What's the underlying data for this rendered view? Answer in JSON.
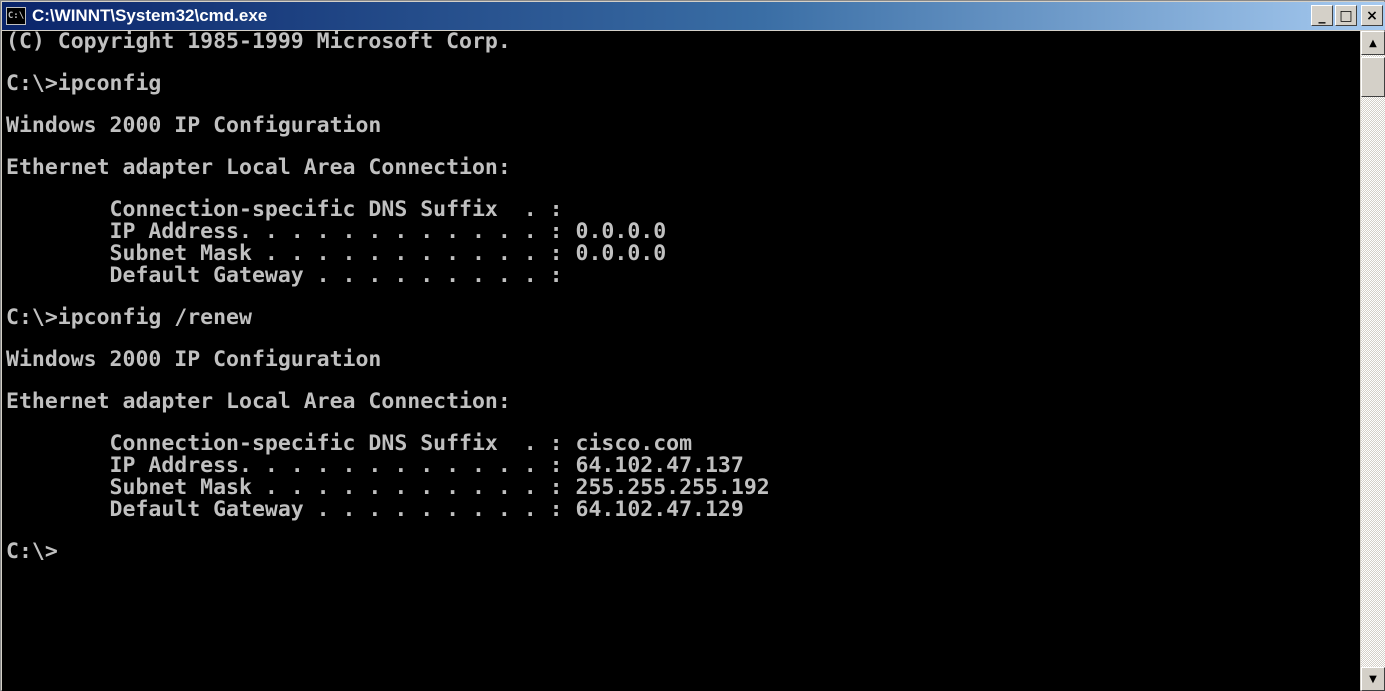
{
  "window": {
    "title": "C:\\WINNT\\System32\\cmd.exe",
    "icon": "cmd-icon"
  },
  "controls": {
    "minimize": "_",
    "maximize": "□",
    "close": "×"
  },
  "console": {
    "lines": [
      "(C) Copyright 1985-1999 Microsoft Corp.",
      "",
      "C:\\>ipconfig",
      "",
      "Windows 2000 IP Configuration",
      "",
      "Ethernet adapter Local Area Connection:",
      "",
      "        Connection-specific DNS Suffix  . :",
      "        IP Address. . . . . . . . . . . . : 0.0.0.0",
      "        Subnet Mask . . . . . . . . . . . : 0.0.0.0",
      "        Default Gateway . . . . . . . . . :",
      "",
      "C:\\>ipconfig /renew",
      "",
      "Windows 2000 IP Configuration",
      "",
      "Ethernet adapter Local Area Connection:",
      "",
      "        Connection-specific DNS Suffix  . : cisco.com",
      "        IP Address. . . . . . . . . . . . : 64.102.47.137",
      "        Subnet Mask . . . . . . . . . . . : 255.255.255.192",
      "        Default Gateway . . . . . . . . . : 64.102.47.129",
      "",
      "C:\\>"
    ]
  },
  "colors": {
    "console_bg": "#000000",
    "console_fg": "#c0c0c0",
    "title_active": "#0a246a"
  }
}
